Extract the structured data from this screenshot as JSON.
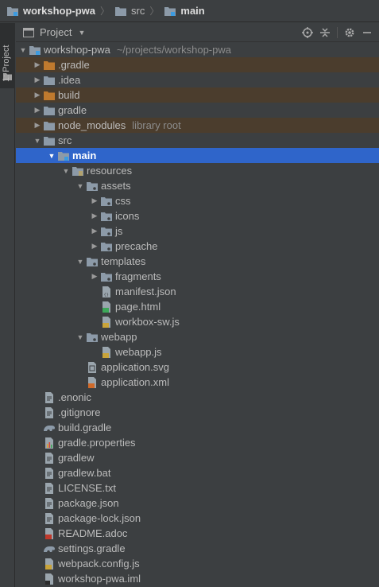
{
  "breadcrumb": {
    "items": [
      "workshop-pwa",
      "src",
      "main"
    ]
  },
  "toolstrip": {
    "tab_label": "1: Project"
  },
  "panel": {
    "title": "Project",
    "tools": [
      "locate-icon",
      "collapse-icon",
      "gear-icon",
      "minimize-icon"
    ]
  },
  "colors": {
    "background": "#3c3f41",
    "selection": "#2f65ca",
    "excluded": "#4b3d2d",
    "folder": "#8c9aa8",
    "excluded_folder": "#c07a2e"
  },
  "tree": [
    {
      "label": "workshop-pwa",
      "hint": "~/projects/workshop-pwa",
      "depth": 0,
      "arrow": "down",
      "icon": "module-folder"
    },
    {
      "label": ".gradle",
      "depth": 1,
      "arrow": "right",
      "icon": "folder-orange",
      "excluded": true
    },
    {
      "label": ".idea",
      "depth": 1,
      "arrow": "right",
      "icon": "folder"
    },
    {
      "label": "build",
      "depth": 1,
      "arrow": "right",
      "icon": "folder-orange",
      "excluded": true
    },
    {
      "label": "gradle",
      "depth": 1,
      "arrow": "right",
      "icon": "folder"
    },
    {
      "label": "node_modules",
      "hint": "library root",
      "depth": 1,
      "arrow": "right",
      "icon": "folder",
      "excluded": true
    },
    {
      "label": "src",
      "depth": 1,
      "arrow": "down",
      "icon": "folder"
    },
    {
      "label": "main",
      "depth": 2,
      "arrow": "down",
      "icon": "module-folder",
      "selected": true
    },
    {
      "label": "resources",
      "depth": 3,
      "arrow": "down",
      "icon": "resources-folder"
    },
    {
      "label": "assets",
      "depth": 4,
      "arrow": "down",
      "icon": "folder-dot"
    },
    {
      "label": "css",
      "depth": 5,
      "arrow": "right",
      "icon": "folder-dot"
    },
    {
      "label": "icons",
      "depth": 5,
      "arrow": "right",
      "icon": "folder-dot"
    },
    {
      "label": "js",
      "depth": 5,
      "arrow": "right",
      "icon": "folder-dot"
    },
    {
      "label": "precache",
      "depth": 5,
      "arrow": "right",
      "icon": "folder-dot"
    },
    {
      "label": "templates",
      "depth": 4,
      "arrow": "down",
      "icon": "folder-dot"
    },
    {
      "label": "fragments",
      "depth": 5,
      "arrow": "right",
      "icon": "folder-dot"
    },
    {
      "label": "manifest.json",
      "depth": 5,
      "arrow": "none",
      "icon": "json-file"
    },
    {
      "label": "page.html",
      "depth": 5,
      "arrow": "none",
      "icon": "html-file"
    },
    {
      "label": "workbox-sw.js",
      "depth": 5,
      "arrow": "none",
      "icon": "js-file"
    },
    {
      "label": "webapp",
      "depth": 4,
      "arrow": "down",
      "icon": "folder-dot"
    },
    {
      "label": "webapp.js",
      "depth": 5,
      "arrow": "none",
      "icon": "js-file"
    },
    {
      "label": "application.svg",
      "depth": 4,
      "arrow": "none",
      "icon": "svg-file"
    },
    {
      "label": "application.xml",
      "depth": 4,
      "arrow": "none",
      "icon": "xml-file"
    },
    {
      "label": ".enonic",
      "depth": 1,
      "arrow": "none",
      "icon": "text-file"
    },
    {
      "label": ".gitignore",
      "depth": 1,
      "arrow": "none",
      "icon": "text-file"
    },
    {
      "label": "build.gradle",
      "depth": 1,
      "arrow": "none",
      "icon": "gradle-file"
    },
    {
      "label": "gradle.properties",
      "depth": 1,
      "arrow": "none",
      "icon": "properties-file"
    },
    {
      "label": "gradlew",
      "depth": 1,
      "arrow": "none",
      "icon": "text-file"
    },
    {
      "label": "gradlew.bat",
      "depth": 1,
      "arrow": "none",
      "icon": "text-file"
    },
    {
      "label": "LICENSE.txt",
      "depth": 1,
      "arrow": "none",
      "icon": "text-file"
    },
    {
      "label": "package.json",
      "depth": 1,
      "arrow": "none",
      "icon": "text-file"
    },
    {
      "label": "package-lock.json",
      "depth": 1,
      "arrow": "none",
      "icon": "text-file"
    },
    {
      "label": "README.adoc",
      "depth": 1,
      "arrow": "none",
      "icon": "adoc-file"
    },
    {
      "label": "settings.gradle",
      "depth": 1,
      "arrow": "none",
      "icon": "gradle-file"
    },
    {
      "label": "webpack.config.js",
      "depth": 1,
      "arrow": "none",
      "icon": "js-file"
    },
    {
      "label": "workshop-pwa.iml",
      "depth": 1,
      "arrow": "none",
      "icon": "iml-file"
    }
  ]
}
